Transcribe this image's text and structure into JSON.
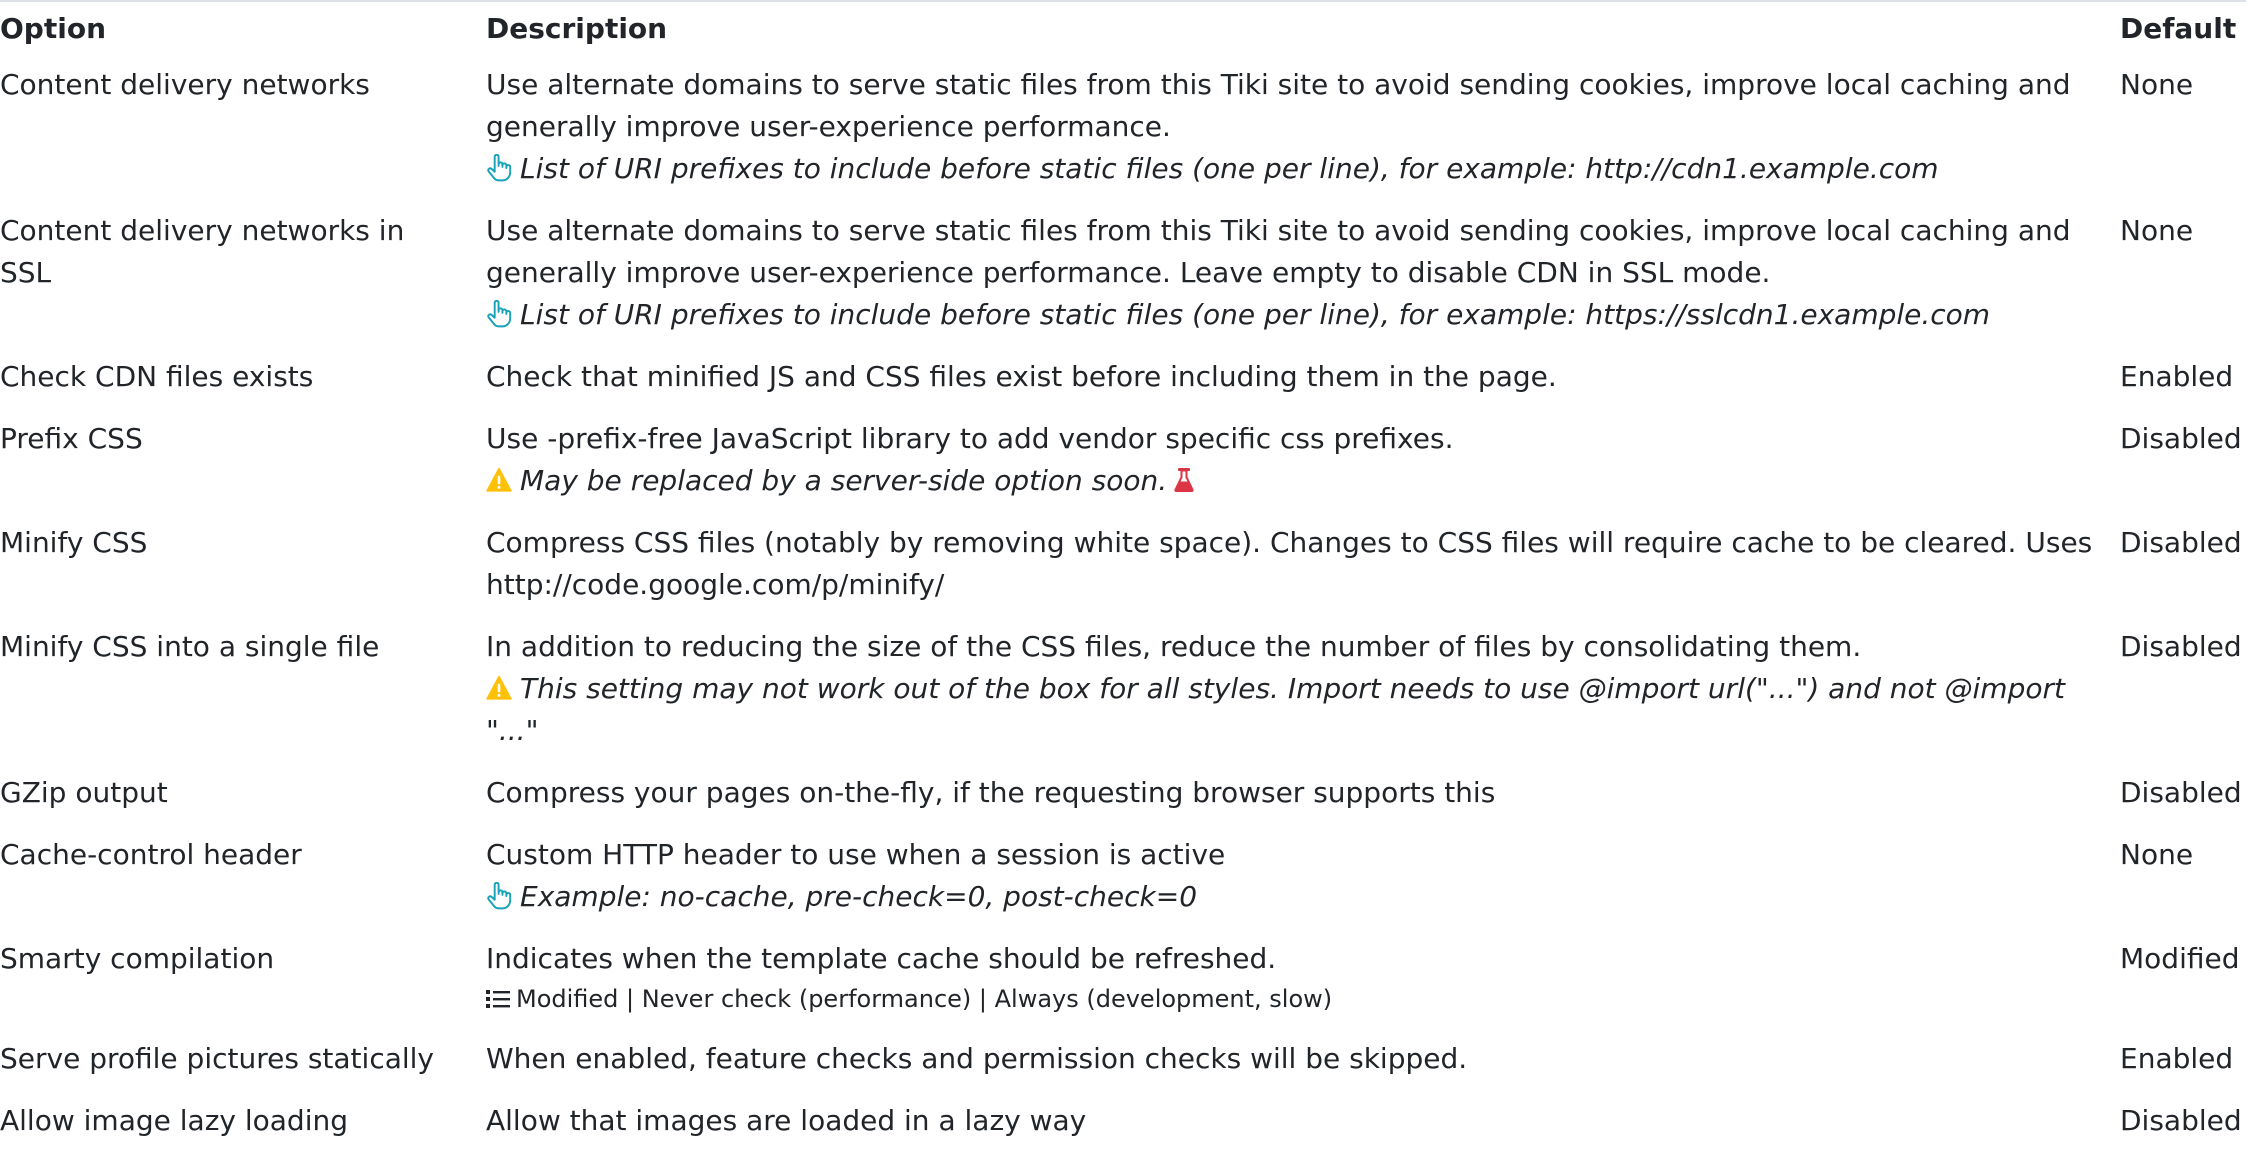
{
  "headers": {
    "option": "Option",
    "description": "Description",
    "default": "Default"
  },
  "rows": [
    {
      "option": "Content delivery networks",
      "description": "Use alternate domains to serve static files from this Tiki site to avoid sending cookies, improve local caching and generally improve user-experience performance.",
      "hint": "List of URI prefixes to include before static files (one per line), for example: http://cdn1.example.com",
      "default": "None"
    },
    {
      "option": "Content delivery networks in SSL",
      "description": "Use alternate domains to serve static files from this Tiki site to avoid sending cookies, improve local caching and generally improve user-experience performance. Leave empty to disable CDN in SSL mode.",
      "hint": "List of URI prefixes to include before static files (one per line), for example: https://sslcdn1.example.com",
      "default": "None"
    },
    {
      "option": "Check CDN files exists",
      "description": "Check that minified JS and CSS files exist before including them in the page.",
      "default": "Enabled"
    },
    {
      "option": "Prefix CSS",
      "description": "Use -prefix-free JavaScript library to add vendor specific css prefixes.",
      "warning": "May be replaced by a server-side option soon.",
      "default": "Disabled"
    },
    {
      "option": "Minify CSS",
      "description": "Compress CSS files (notably by removing white space). Changes to CSS files will require cache to be cleared. Uses http://code.google.com/p/minify/",
      "default": "Disabled"
    },
    {
      "option": "Minify CSS into a single file",
      "description": "In addition to reducing the size of the CSS files, reduce the number of files by consolidating them.",
      "warning": "This setting may not work out of the box for all styles. Import needs to use @import url(\"...\") and not @import \"...\"",
      "default": "Disabled"
    },
    {
      "option": "GZip output",
      "description": "Compress your pages on-the-fly, if the requesting browser supports this",
      "default": "Disabled"
    },
    {
      "option": "Cache-control header",
      "description": "Custom HTTP header to use when a session is active",
      "hint": "Example: no-cache, pre-check=0, post-check=0",
      "default": "None"
    },
    {
      "option": "Smarty compilation",
      "description": "Indicates when the template cache should be refreshed.",
      "options": "Modified | Never check (performance) | Always (development, slow)",
      "default": "Modified"
    },
    {
      "option": "Serve profile pictures statically",
      "description": "When enabled, feature checks and permission checks will be skipped.",
      "default": "Enabled"
    },
    {
      "option": "Allow image lazy loading",
      "description": "Allow that images are loaded in a lazy way",
      "default": "Disabled"
    }
  ],
  "icons": {
    "hint": "hand-pointer-icon",
    "warning": "warning-icon",
    "experimental": "flask-icon",
    "options": "list-icon"
  },
  "colors": {
    "hint_icon": "#17a2b8",
    "warning_icon": "#ffc107",
    "experimental_icon": "#dc3545",
    "text": "#212529"
  }
}
